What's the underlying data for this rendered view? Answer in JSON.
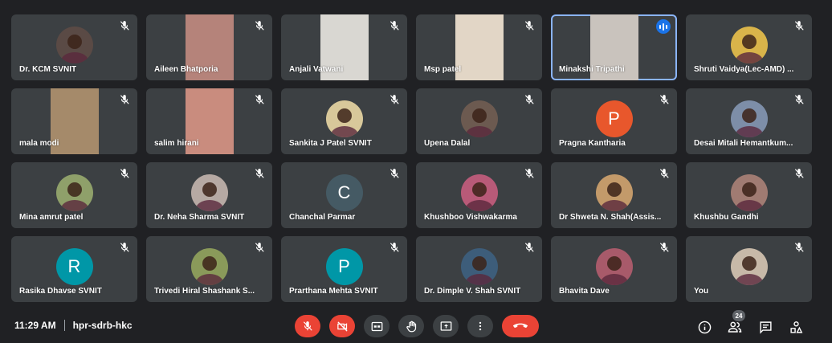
{
  "participants": [
    {
      "name": "Dr. KCM SVNIT",
      "type": "photo",
      "bg": "#5a4a45"
    },
    {
      "name": "Aileen Bhatporia",
      "type": "video",
      "bg": "#b5837a"
    },
    {
      "name": "Anjali Vatwani",
      "type": "video",
      "bg": "#d9d7d2"
    },
    {
      "name": "Msp patel",
      "type": "video",
      "bg": "#e2d6c6"
    },
    {
      "name": "Minakshi Tripathi",
      "type": "video",
      "bg": "#c9c3bd",
      "speaking": true
    },
    {
      "name": "Shruti Vaidya(Lec-AMD) ...",
      "type": "photo",
      "bg": "#d9b44a"
    },
    {
      "name": "mala modi",
      "type": "video",
      "bg": "#a58a6a"
    },
    {
      "name": "salim hirani",
      "type": "video",
      "bg": "#c98c7e"
    },
    {
      "name": "Sankita J Patel SVNIT",
      "type": "photo",
      "bg": "#d8c89a"
    },
    {
      "name": "Upena Dalal",
      "type": "photo",
      "bg": "#6c5a50"
    },
    {
      "name": "Pragna Kantharia",
      "type": "initial",
      "initial": "P",
      "bg": "#e8572c"
    },
    {
      "name": "Desai Mitali Hemantkum...",
      "type": "photo",
      "bg": "#7d8ea8"
    },
    {
      "name": "Mina amrut patel",
      "type": "photo",
      "bg": "#8fa06a"
    },
    {
      "name": "Dr. Neha Sharma SVNIT",
      "type": "photo",
      "bg": "#b6a9a3"
    },
    {
      "name": "Chanchal Parmar",
      "type": "initial",
      "initial": "C",
      "bg": "#455a64"
    },
    {
      "name": "Khushboo Vishwakarma",
      "type": "photo",
      "bg": "#b85a78"
    },
    {
      "name": "Dr Shweta N. Shah(Assis...",
      "type": "photo",
      "bg": "#c39a6a"
    },
    {
      "name": "Khushbu Gandhi",
      "type": "photo",
      "bg": "#a07b72"
    },
    {
      "name": "Rasika Dhavse SVNIT",
      "type": "initial",
      "initial": "R",
      "bg": "#0097a7"
    },
    {
      "name": "Trivedi Hiral Shashank S...",
      "type": "photo",
      "bg": "#8a9a5a"
    },
    {
      "name": "Prarthana Mehta SVNIT",
      "type": "initial",
      "initial": "P",
      "bg": "#0097a7"
    },
    {
      "name": "Dr. Dimple V. Shah SVNIT",
      "type": "photo",
      "bg": "#3d5d7a"
    },
    {
      "name": "Bhavita Dave",
      "type": "photo",
      "bg": "#a85a6a"
    },
    {
      "name": "You",
      "type": "photo",
      "bg": "#c7b9a8"
    }
  ],
  "footer": {
    "time": "11:29 AM",
    "meeting_code": "hpr-sdrb-hkc",
    "participant_count": "24"
  },
  "controls": [
    {
      "name": "mic-off-button",
      "icon": "mic-off-icon",
      "color": "red"
    },
    {
      "name": "camera-off-button",
      "icon": "camera-off-icon",
      "color": "red"
    },
    {
      "name": "captions-button",
      "icon": "captions-icon",
      "color": "gray"
    },
    {
      "name": "raise-hand-button",
      "icon": "hand-icon",
      "color": "gray"
    },
    {
      "name": "present-button",
      "icon": "present-icon",
      "color": "gray"
    },
    {
      "name": "more-options-button",
      "icon": "more-vert-icon",
      "color": "gray"
    },
    {
      "name": "leave-call-button",
      "icon": "call-end-icon",
      "color": "end"
    }
  ],
  "colors": {
    "background": "#202124",
    "tile": "#3c4043",
    "danger": "#ea4335",
    "speaking_accent": "#1a73e8"
  }
}
